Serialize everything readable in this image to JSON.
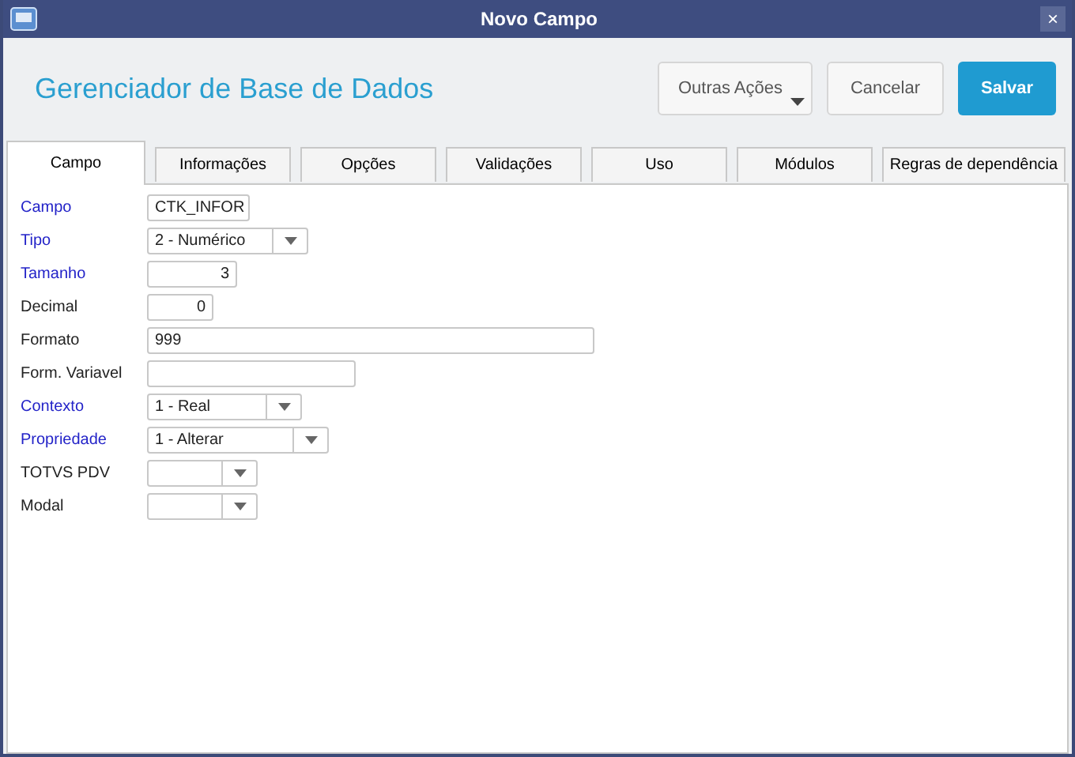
{
  "window": {
    "title": "Novo Campo",
    "close": "×"
  },
  "header": {
    "title": "Gerenciador de Base de Dados",
    "buttons": [
      {
        "label": "Outras Ações",
        "kind": "menu"
      },
      {
        "label": "Cancelar",
        "kind": "plain"
      },
      {
        "label": "Salvar",
        "kind": "primary"
      }
    ]
  },
  "tabs": [
    {
      "label": "Campo",
      "selected": true
    },
    {
      "label": "Informações",
      "selected": false
    },
    {
      "label": "Opções",
      "selected": false
    },
    {
      "label": "Validações",
      "selected": false
    },
    {
      "label": "Uso",
      "selected": false
    },
    {
      "label": "Módulos",
      "selected": false
    },
    {
      "label": "Regras de dependência",
      "selected": false
    }
  ],
  "fields": [
    {
      "label": "Campo",
      "required": true,
      "kind": "text",
      "value": "CTK_INFOR"
    },
    {
      "label": "Tipo",
      "required": true,
      "kind": "select",
      "value": "2 - Numérico"
    },
    {
      "label": "Tamanho",
      "required": true,
      "kind": "number",
      "value": "3"
    },
    {
      "label": "Decimal",
      "required": false,
      "kind": "number",
      "value": "0"
    },
    {
      "label": "Formato",
      "required": false,
      "kind": "text",
      "value": "999"
    },
    {
      "label": "Form. Variavel",
      "required": false,
      "kind": "text"
    },
    {
      "label": "Contexto",
      "required": true,
      "kind": "select",
      "value": "1 - Real"
    },
    {
      "label": "Propriedade",
      "required": true,
      "kind": "select",
      "value": "1 - Alterar"
    },
    {
      "label": "TOTVS PDV",
      "required": false,
      "kind": "select"
    },
    {
      "label": "Modal",
      "required": false,
      "kind": "select"
    }
  ]
}
